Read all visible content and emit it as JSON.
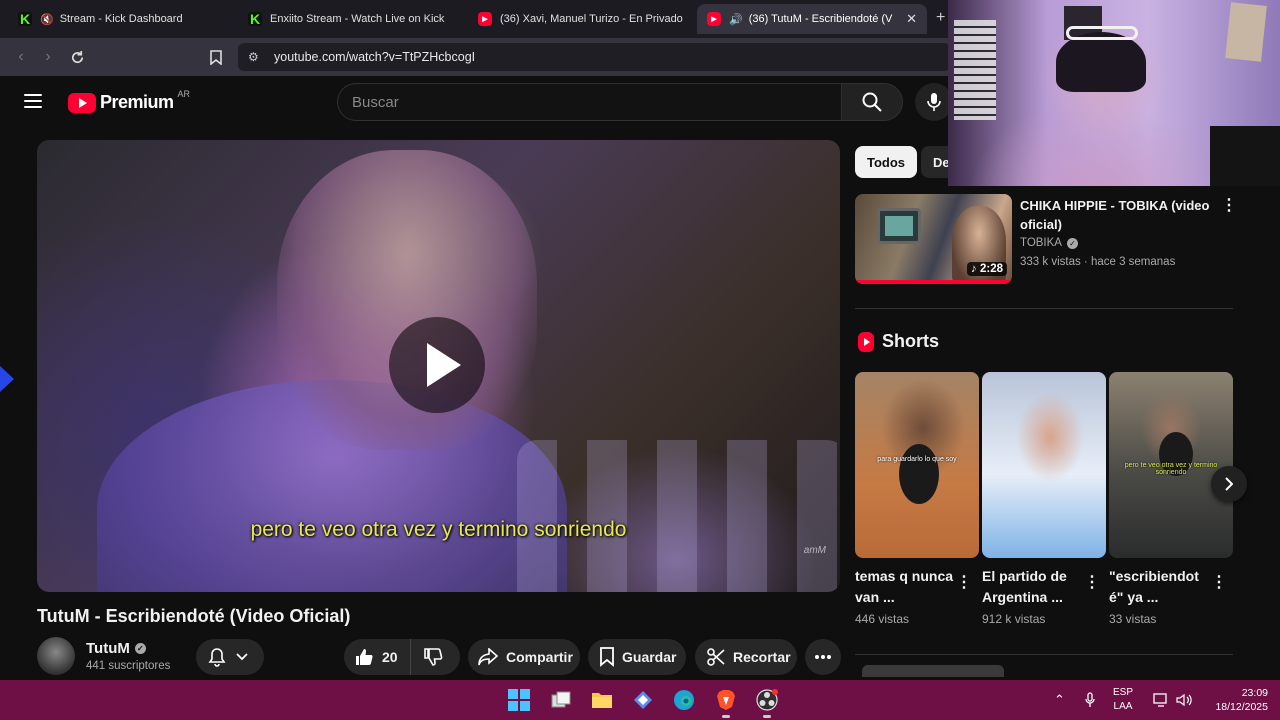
{
  "browser": {
    "tabs": [
      {
        "title": "Stream - Kick Dashboard",
        "favicon": "kick-icon",
        "muted": true
      },
      {
        "title": "Enxiito Stream - Watch Live on Kick",
        "favicon": "kick-icon"
      },
      {
        "title": "(36) Xavi, Manuel Turizo - En Privado",
        "favicon": "youtube-icon"
      },
      {
        "title": "(36) TutuM - Escribiendoté (V",
        "favicon": "youtube-icon",
        "active": true,
        "audio": true
      }
    ],
    "url": "youtube.com/watch?v=TtPZHcbcogI"
  },
  "youtube": {
    "logo_text": "Premium",
    "country": "AR",
    "search_placeholder": "Buscar",
    "video": {
      "subtitle": "pero te veo otra vez y termino sonriendo",
      "watermark": "amM",
      "title": "TutuM - Escribiendoté (Video Oficial)",
      "channel": "TutuM",
      "subscribers": "441 suscriptores",
      "likes": "20",
      "share_label": "Compartir",
      "save_label": "Guardar",
      "clip_label": "Recortar"
    },
    "chips": [
      "Todos",
      "De"
    ],
    "recommended": {
      "title": "CHIKA HIPPIE - TOBIKA (video oficial)",
      "channel": "TOBIKA",
      "meta": "333 k vistas · hace 3 semanas",
      "duration": "2:28",
      "watched_fraction": 1.0
    },
    "shorts_heading": "Shorts",
    "shorts": [
      {
        "title": "temas q nunca van ...",
        "views": "446 vistas",
        "caption": "para guardarlo lo que soy"
      },
      {
        "title": "El partido de Argentina ...",
        "views": "912 k vistas",
        "caption": ""
      },
      {
        "title": "\"escribiendot é\" ya ...",
        "views": "33 vistas",
        "caption": "pero te veo otra vez y termino sonriendo"
      }
    ]
  },
  "taskbar": {
    "lang_top": "ESP",
    "lang_bottom": "LAA",
    "time": "23:09",
    "date": "18/12/2025"
  },
  "colors": {
    "youtube_red": "#ff0033",
    "kick_green": "#53fc18",
    "taskbar": "#6e0f45",
    "subtitle_yellow": "#e8e84a"
  }
}
